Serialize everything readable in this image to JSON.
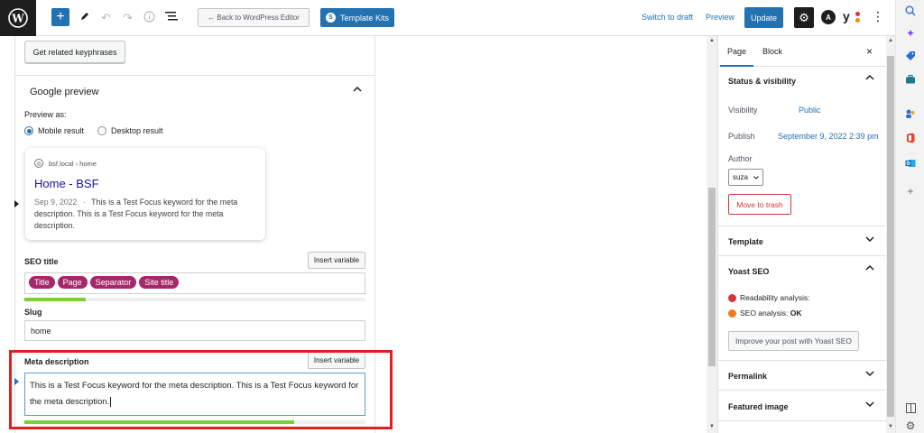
{
  "toolbar": {
    "logo_icon": "wordpress-logo-icon",
    "add_label": "+",
    "back_label": "← Back to WordPress Editor",
    "kits_badge": "S",
    "kits_label": "Template Kits",
    "switch_draft": "Switch to draft",
    "preview": "Preview",
    "update": "Update",
    "more": "⋮",
    "astra_letter": "A",
    "yoast_letter": "y"
  },
  "editor": {
    "related_btn": "Get related keyphrases",
    "google_preview": {
      "title": "Google preview",
      "preview_as": "Preview as:",
      "mobile": "Mobile result",
      "desktop": "Desktop result",
      "selected": "mobile",
      "site": "bsf.local › home",
      "result_title": "Home - BSF",
      "date": "Sep 9, 2022",
      "date_sep": "·",
      "desc": "This is a Test Focus keyword for the meta description. This is a Test Focus keyword for the meta description."
    },
    "seo_title": {
      "label": "SEO title",
      "insert_variable": "Insert variable",
      "chips": [
        "Title",
        "Page",
        "Separator",
        "Site title"
      ],
      "progress": 0.18
    },
    "slug": {
      "label": "Slug",
      "value": "home"
    },
    "meta_description": {
      "label": "Meta description",
      "insert_variable": "Insert variable",
      "value": "This is a Test Focus keyword for the meta description. This is a Test Focus keyword for the meta description.",
      "progress": 0.79
    }
  },
  "settings": {
    "tabs": [
      "Page",
      "Block"
    ],
    "close": "×",
    "status": {
      "title": "Status & visibility",
      "visibility_label": "Visibility",
      "visibility_value": "Public",
      "publish_label": "Publish",
      "publish_value": "September 9, 2022 2:39 pm",
      "author_label": "Author",
      "author_value": "suza",
      "trash": "Move to trash"
    },
    "template": "Template",
    "yoast": {
      "title": "Yoast SEO",
      "readability": "Readability analysis:",
      "seo": "SEO analysis: ",
      "seo_status": "OK",
      "improve": "Improve your post with Yoast SEO",
      "colors": {
        "readability": "#d63638",
        "seo": "#ee7c1b"
      }
    },
    "permalink": "Permalink",
    "featured": "Featured image"
  },
  "accent": "#2271b1"
}
